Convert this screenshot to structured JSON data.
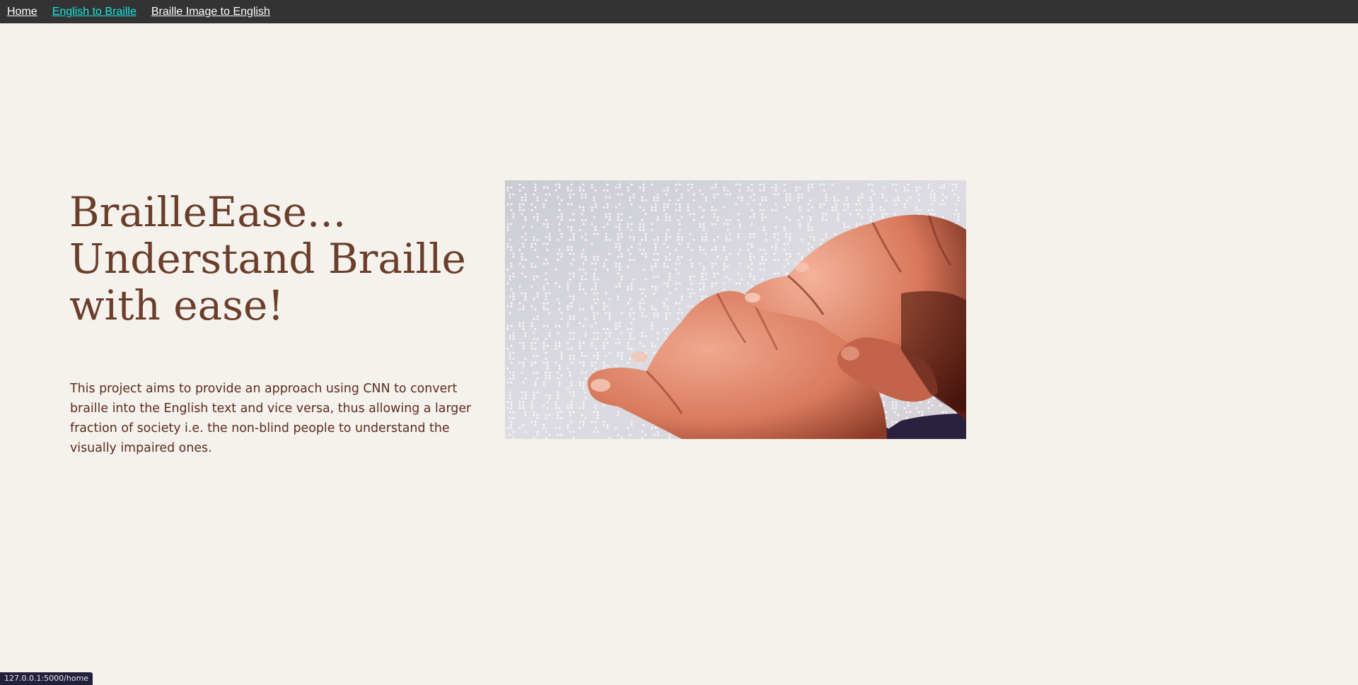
{
  "nav": {
    "items": [
      {
        "label": "Home",
        "active": false
      },
      {
        "label": "English to Braille",
        "active": true
      },
      {
        "label": "Braille Image to English",
        "active": false
      }
    ]
  },
  "hero": {
    "title_line1": "BrailleEase...",
    "title_line2": "Understand Braille",
    "title_line3": "with ease!",
    "description": "This project aims to provide an approach using CNN to convert braille into the English text and vice versa, thus allowing a larger fraction of society i.e. the non-blind people to understand the visually impaired ones."
  },
  "status_bar": {
    "url": "127.0.0.1:5000/home"
  },
  "colors": {
    "page_bg": "#f5f1ec",
    "nav_bg": "#333333",
    "nav_active": "#19e6e1",
    "title": "#6b3e2b",
    "body_text": "#5c2e1e"
  }
}
